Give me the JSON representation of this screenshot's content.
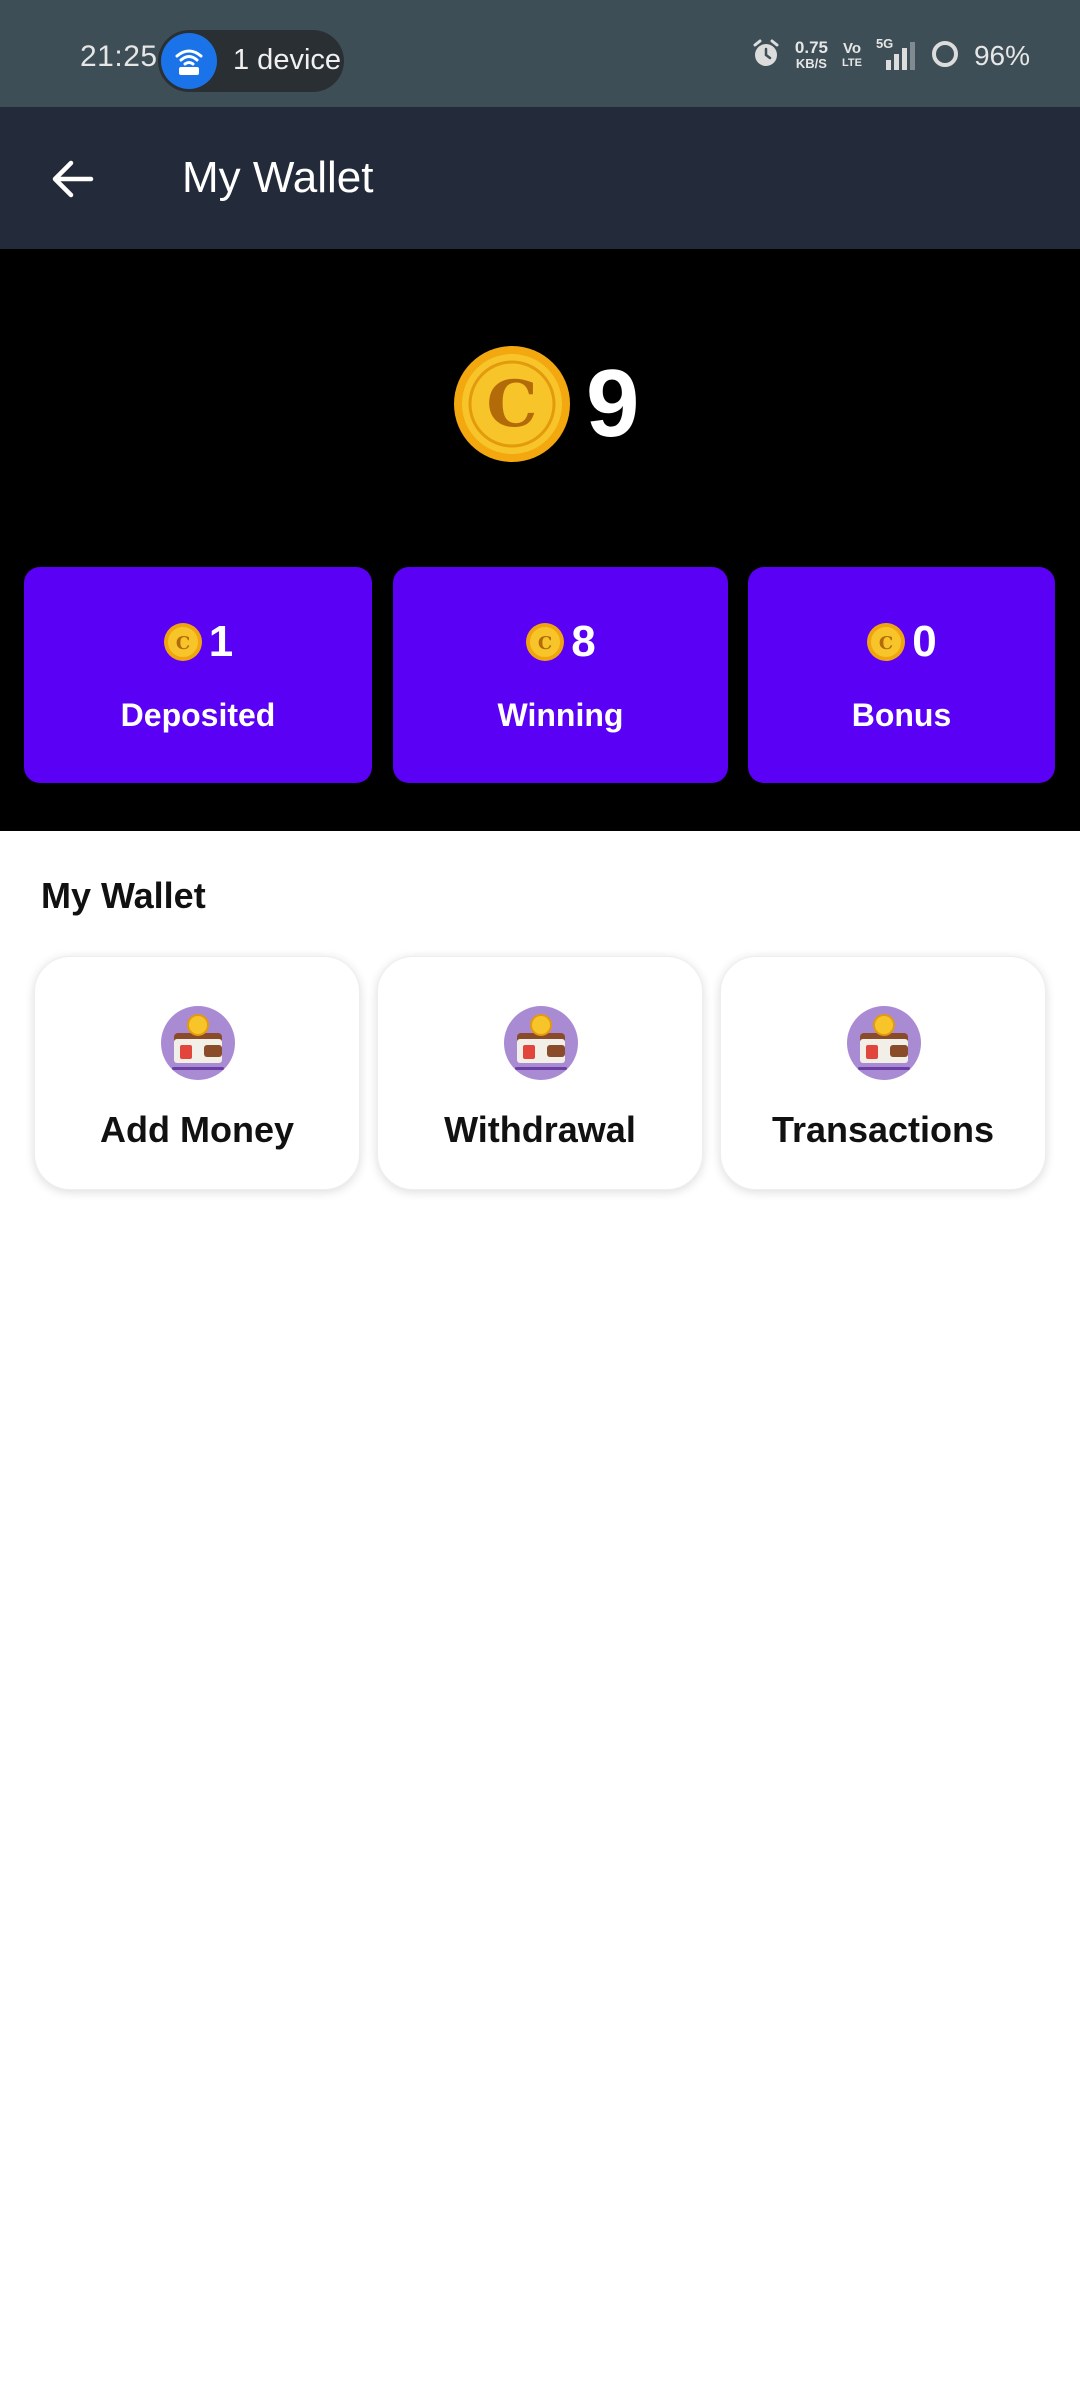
{
  "status_bar": {
    "time": "21:25",
    "hotspot_label": "1 device",
    "speed_value": "0.75",
    "speed_unit": "KB/S",
    "volte_top": "Vo",
    "volte_bottom": "LTE",
    "network": "5G",
    "battery": "96%"
  },
  "app_bar": {
    "title": "My Wallet",
    "back_icon": "arrow-left-icon"
  },
  "balance": {
    "total": "9",
    "coin_icon": "coin-icon",
    "cards": [
      {
        "value": "1",
        "label": "Deposited"
      },
      {
        "value": "8",
        "label": "Winning"
      },
      {
        "value": "0",
        "label": "Bonus"
      }
    ]
  },
  "menu": {
    "title": "My Wallet",
    "items": [
      {
        "label": "Add Money",
        "icon": "wallet-icon"
      },
      {
        "label": "Withdrawal",
        "icon": "wallet-icon"
      },
      {
        "label": "Transactions",
        "icon": "wallet-icon"
      }
    ]
  },
  "colors": {
    "status_bar": "#3e4e56",
    "app_bar": "#232a3a",
    "balance_bg": "#000000",
    "card_purple": "#5a00f5",
    "coin_gold": "#f5b91e"
  }
}
